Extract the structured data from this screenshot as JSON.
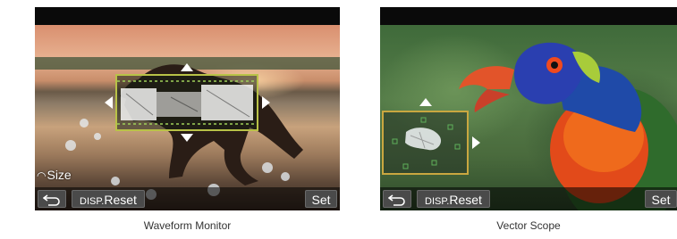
{
  "panels": [
    {
      "size_label": "Size",
      "buttons": {
        "back_icon": "return-arrow-icon",
        "disp_label": "DISP.",
        "reset_label": "Reset",
        "set_label": "Set"
      },
      "caption": "Waveform Monitor"
    },
    {
      "buttons": {
        "back_icon": "return-arrow-icon",
        "disp_label": "DISP.",
        "reset_label": "Reset",
        "set_label": "Set"
      },
      "caption": "Vector Scope"
    }
  ],
  "colors": {
    "frame_border": "#c9b24a",
    "waveform_frame": "#b9c247",
    "button_bg": "#4a4a4a"
  }
}
